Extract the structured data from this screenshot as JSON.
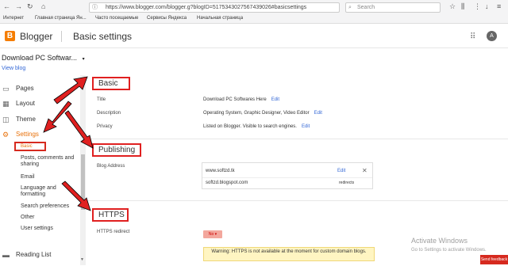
{
  "browser": {
    "url": "https://www.blogger.com/blogger.g?blogID=5175343027567439026#basicsettings",
    "search_placeholder": "Search",
    "bookmarks": [
      "Интернет",
      "Главная страница Ян...",
      "Часто посещаемые",
      "Сервисы Яндекса",
      "Начальная страница"
    ]
  },
  "header": {
    "logo_letter": "B",
    "brand": "Blogger",
    "page_title": "Basic settings",
    "avatar_letter": "A"
  },
  "sidebar": {
    "blog_selector": "Download PC Softwar...",
    "view_blog": "View blog",
    "items": [
      {
        "label": "Pages",
        "icon": "▭"
      },
      {
        "label": "Layout",
        "icon": "▦"
      },
      {
        "label": "Theme",
        "icon": "◫"
      },
      {
        "label": "Settings",
        "icon": "⚙"
      }
    ],
    "settings_sub": [
      "Basic",
      "Posts, comments and sharing",
      "Email",
      "Language and formatting",
      "Search preferences",
      "Other",
      "User settings"
    ],
    "reading_list": {
      "label": "Reading List",
      "icon": "▬"
    }
  },
  "main": {
    "basic": {
      "heading": "Basic",
      "rows": [
        {
          "label": "Title",
          "value": "Download PC Softwares Here",
          "action": "Edit"
        },
        {
          "label": "Description",
          "value": "Operating System, Graphic Designer, Video Editor",
          "action": "Edit"
        },
        {
          "label": "Privacy",
          "value": "Listed on Blogger. Visible to search engines.",
          "action": "Edit"
        }
      ]
    },
    "publishing": {
      "heading": "Publishing",
      "blog_address_label": "Blog Address",
      "custom_domain": "www.softzd.tk",
      "custom_domain_action": "Edit",
      "blogspot": "softzd.blogspot.com",
      "blogspot_note": "redirects"
    },
    "https": {
      "heading": "HTTPS",
      "redirect_label": "HTTPS redirect",
      "toggle_label": "No ▾",
      "warning": "Warning: HTTPS is not available at the moment for custom domain blogs."
    }
  },
  "overlay": {
    "activate_title": "Activate Windows",
    "activate_sub": "Go to Settings to activate Windows.",
    "feedback": "Send feedback"
  },
  "colors": {
    "accent": "#e8710a",
    "annotation_red": "#e02020",
    "link": "#3367d6"
  }
}
